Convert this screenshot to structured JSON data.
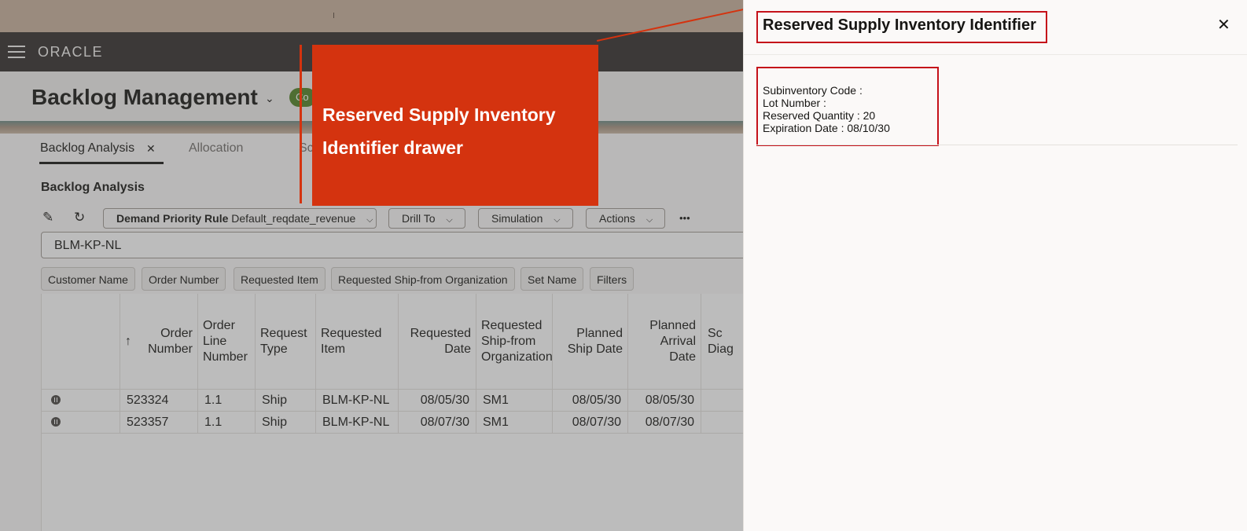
{
  "app": {
    "logo": "ORACLE",
    "page_title": "Backlog Management",
    "status_pill": "Co"
  },
  "tabs": [
    {
      "label": "Backlog Analysis"
    },
    {
      "label": "Allocation"
    },
    {
      "label": "Sc"
    }
  ],
  "section_title": "Backlog Analysis",
  "toolbar": {
    "demand_rule_label": "Demand Priority Rule",
    "demand_rule_value": "Default_reqdate_revenue",
    "drill_to": "Drill To",
    "simulation": "Simulation",
    "actions": "Actions",
    "more": "•••"
  },
  "search": {
    "value": "BLM-KP-NL"
  },
  "chips": [
    "Customer Name",
    "Order Number",
    "Requested Item",
    "Requested Ship-from Organization",
    "Set Name",
    "Filters"
  ],
  "table": {
    "sort_indicator": "↑",
    "headers": [
      "Order Number",
      "Order Line Number",
      "Request Type",
      "Requested Item",
      "Requested Date",
      "Requested Ship-from Organization",
      "Planned Ship Date",
      "Planned Arrival Date",
      "Sc Diag"
    ],
    "rows": [
      [
        "523324",
        "1.1",
        "Ship",
        "BLM-KP-NL",
        "08/05/30",
        "SM1",
        "08/05/30",
        "08/05/30",
        ""
      ],
      [
        "523357",
        "1.1",
        "Ship",
        "BLM-KP-NL",
        "08/07/30",
        "SM1",
        "08/07/30",
        "08/07/30",
        ""
      ]
    ]
  },
  "callout": {
    "line1": "Reserved Supply Inventory",
    "line2": "Identifier drawer"
  },
  "drawer": {
    "title": "Reserved Supply Inventory Identifier",
    "details": [
      "Subinventory Code :",
      "Lot Number :",
      "Reserved Quantity : 20",
      "Expiration Date : 08/10/30"
    ]
  },
  "colors": {
    "callout": "#d4330f",
    "highlight_border": "#c5111a",
    "navbar": "#312d2a",
    "status_pill": "#508223"
  },
  "icons": [
    "hamburger-icon",
    "title-chevron-icon",
    "tab-close-icon",
    "edit-icon",
    "refresh-icon",
    "chevron-down-icon",
    "more-icon",
    "sort-ascending-icon",
    "row-status-icon",
    "close-icon"
  ]
}
